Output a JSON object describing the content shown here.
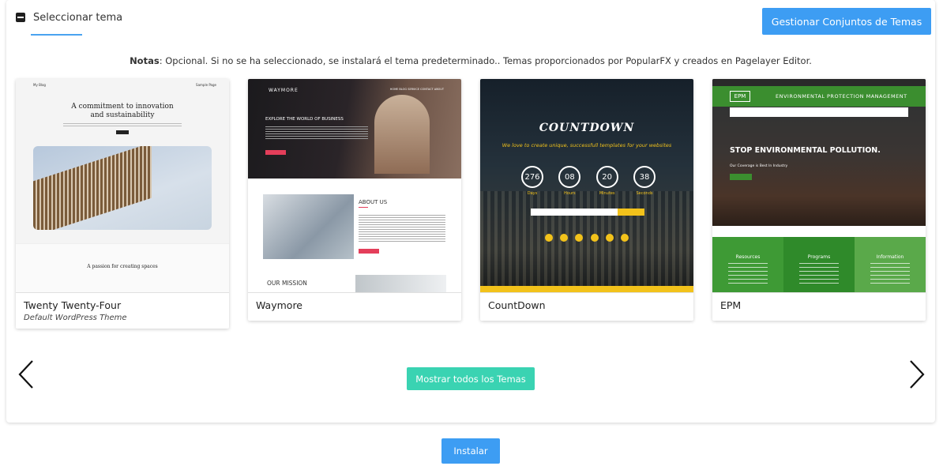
{
  "section": {
    "title": "Seleccionar tema",
    "manage_button": "Gestionar Conjuntos de Temas"
  },
  "notes": {
    "label": "Notas",
    "text": ": Opcional. Si no se ha seleccionado, se instalará el tema predeterminado.. Temas proporcionados por PopularFX y creados en Pagelayer Editor."
  },
  "themes": [
    {
      "name": "Twenty Twenty-Four",
      "subtitle": "Default WordPress Theme",
      "thumb": {
        "blog": "My Blog",
        "nav": "Sample Page",
        "headline1": "A commitment to innovation",
        "headline2": "and sustainability",
        "footer_title": "A passion for creating spaces"
      }
    },
    {
      "name": "Waymore",
      "thumb": {
        "logo": "WAYMORE",
        "nav": "HOME   BLOG   SERVICE   CONTACT   ABOUT",
        "heading": "EXPLORE THE WORLD OF BUSINESS",
        "about": "ABOUT US",
        "mission": "OUR MISSION"
      }
    },
    {
      "name": "CountDown",
      "thumb": {
        "title": "COUNTDOWN",
        "tagline": "We love to create unique, successfull templates for your websites",
        "counters": [
          {
            "value": "276",
            "label": "Days"
          },
          {
            "value": "08",
            "label": "Hours"
          },
          {
            "value": "20",
            "label": "Minutes"
          },
          {
            "value": "38",
            "label": "Seconds"
          }
        ]
      }
    },
    {
      "name": "EPM",
      "thumb": {
        "logo": "EPM",
        "org": "ENVIRONMENTAL PROTECTION MANAGEMENT",
        "headline": "STOP ENVIRONMENTAL POLLUTION.",
        "sub": "Our Coverage is Best In Industry",
        "columns": [
          "Resources",
          "Programs",
          "Information"
        ]
      }
    }
  ],
  "show_all_button": "Mostrar todos los Temas",
  "install_button": "Instalar",
  "colors": {
    "primary": "#3d9df3",
    "teal": "#3ad3b2",
    "epm_green": "#3b8e2f",
    "countdown_yellow": "#f2c21b",
    "waymore_red": "#e43e5a"
  }
}
